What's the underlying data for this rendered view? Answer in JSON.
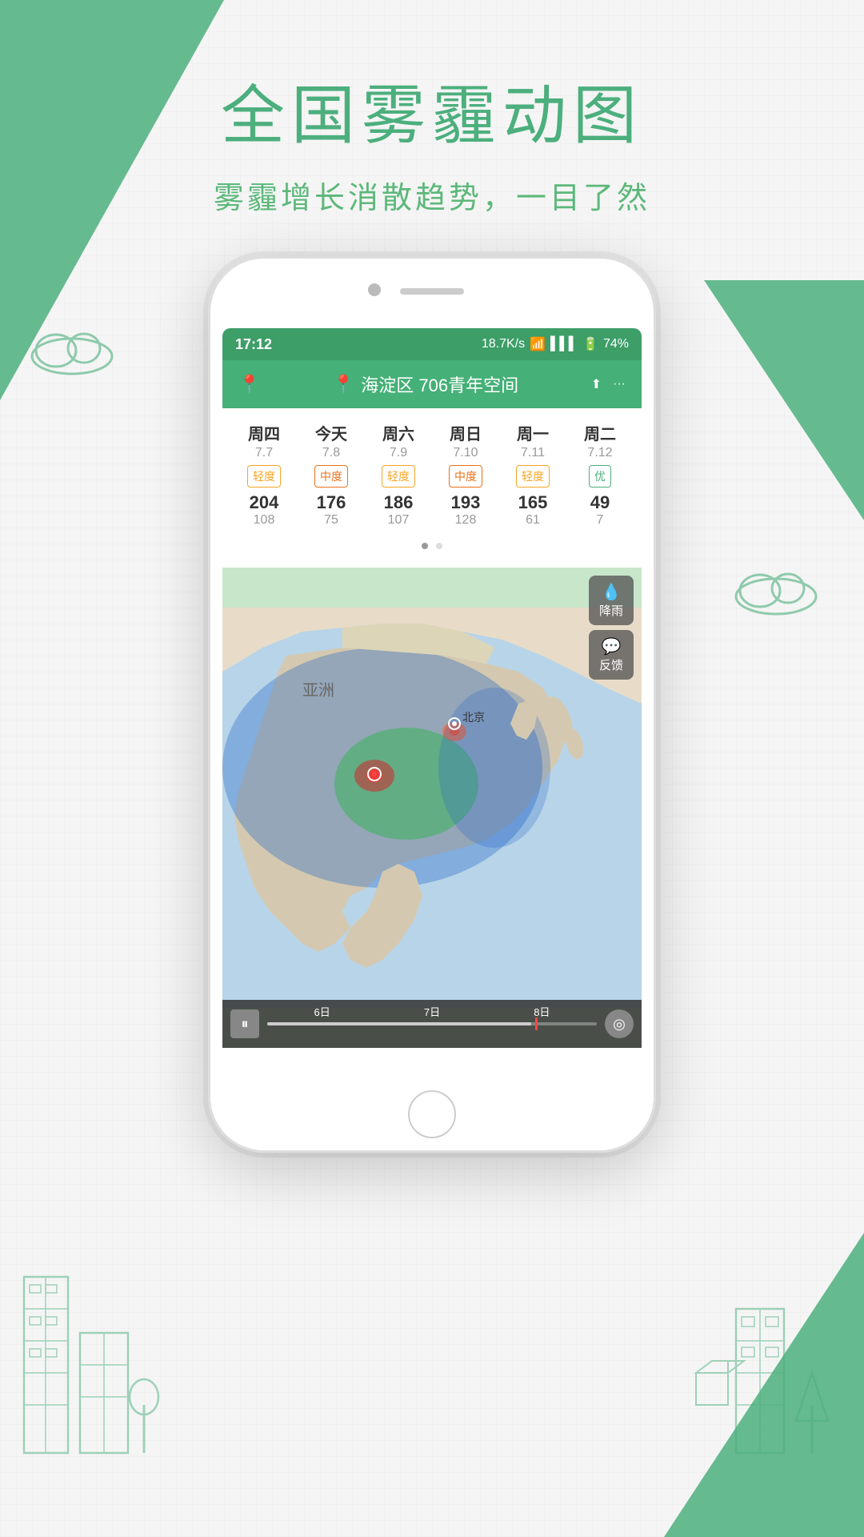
{
  "page": {
    "title": "全国雾霾动图",
    "subtitle": "雾霾增长消散趋势，一目了然"
  },
  "status_bar": {
    "time": "17:12",
    "speed": "18.7K/s",
    "battery": "74%"
  },
  "header": {
    "location_icon": "📍",
    "location": "海淀区 706青年空间",
    "share_icon": "⬆",
    "more_icon": "···"
  },
  "forecast": {
    "days": [
      {
        "name": "周四",
        "date": "7.7",
        "badge": "轻度",
        "badge_type": "light",
        "aqi": "204",
        "aqi2": "108"
      },
      {
        "name": "今天",
        "date": "7.8",
        "badge": "中度",
        "badge_type": "medium",
        "aqi": "176",
        "aqi2": "75"
      },
      {
        "name": "周六",
        "date": "7.9",
        "badge": "轻度",
        "badge_type": "light",
        "aqi": "186",
        "aqi2": "107"
      },
      {
        "name": "周日",
        "date": "7.10",
        "badge": "中度",
        "badge_type": "medium",
        "aqi": "193",
        "aqi2": "128"
      },
      {
        "name": "周一",
        "date": "7.11",
        "badge": "轻度",
        "badge_type": "light",
        "aqi": "165",
        "aqi2": "61"
      },
      {
        "name": "周二",
        "date": "7.12",
        "badge": "优",
        "badge_type": "good",
        "aqi": "49",
        "aqi2": "7"
      }
    ]
  },
  "map": {
    "rain_label": "降雨",
    "feedback_label": "反馈",
    "asia_label": "亚洲",
    "beijing_label": "北京"
  },
  "timeline": {
    "label_1": "6日",
    "label_2": "7日",
    "label_3": "8日",
    "play_icon": "⏸",
    "location_icon": "◎"
  },
  "colors": {
    "green": "#45b077",
    "green_dark": "#3d9e68",
    "green_light": "#4caf7d"
  }
}
